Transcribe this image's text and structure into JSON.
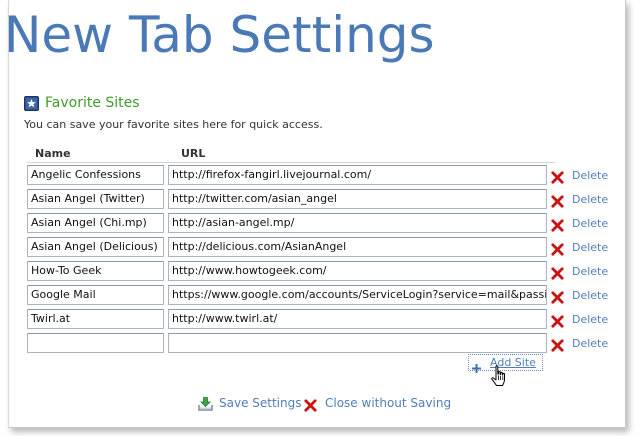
{
  "page": {
    "title": "New Tab Settings"
  },
  "favorites": {
    "heading": "Favorite Sites",
    "description": "You can save your favorite sites here for quick access.",
    "columns": {
      "name": "Name",
      "url": "URL"
    },
    "delete_label": "Delete",
    "rows": [
      {
        "name": "Angelic Confessions",
        "url": "http://firefox-fangirl.livejournal.com/"
      },
      {
        "name": "Asian Angel (Twitter)",
        "url": "http://twitter.com/asian_angel"
      },
      {
        "name": "Asian Angel (Chi.mp)",
        "url": "http://asian-angel.mp/"
      },
      {
        "name": "Asian Angel (Delicious)",
        "url": "http://delicious.com/AsianAngel"
      },
      {
        "name": "How-To Geek",
        "url": "http://www.howtogeek.com/"
      },
      {
        "name": "Google Mail",
        "url": "https://www.google.com/accounts/ServiceLogin?service=mail&passive=true"
      },
      {
        "name": "Twirl.at",
        "url": "http://www.twirl.at/"
      },
      {
        "name": "",
        "url": ""
      }
    ],
    "add_label": "Add Site"
  },
  "footer": {
    "save_label": "Save Settings",
    "close_label": "Close without Saving"
  },
  "colors": {
    "title": "#4a79b6",
    "section_heading": "#3c9d2a",
    "link": "#4f7fb5",
    "delete_x": "#cc1111"
  },
  "icons": {
    "section": "star-icon",
    "delete": "red-x-icon",
    "add": "plus-icon",
    "save": "save-arrow-icon",
    "close": "red-x-icon",
    "pointer": "hand-cursor-icon"
  }
}
